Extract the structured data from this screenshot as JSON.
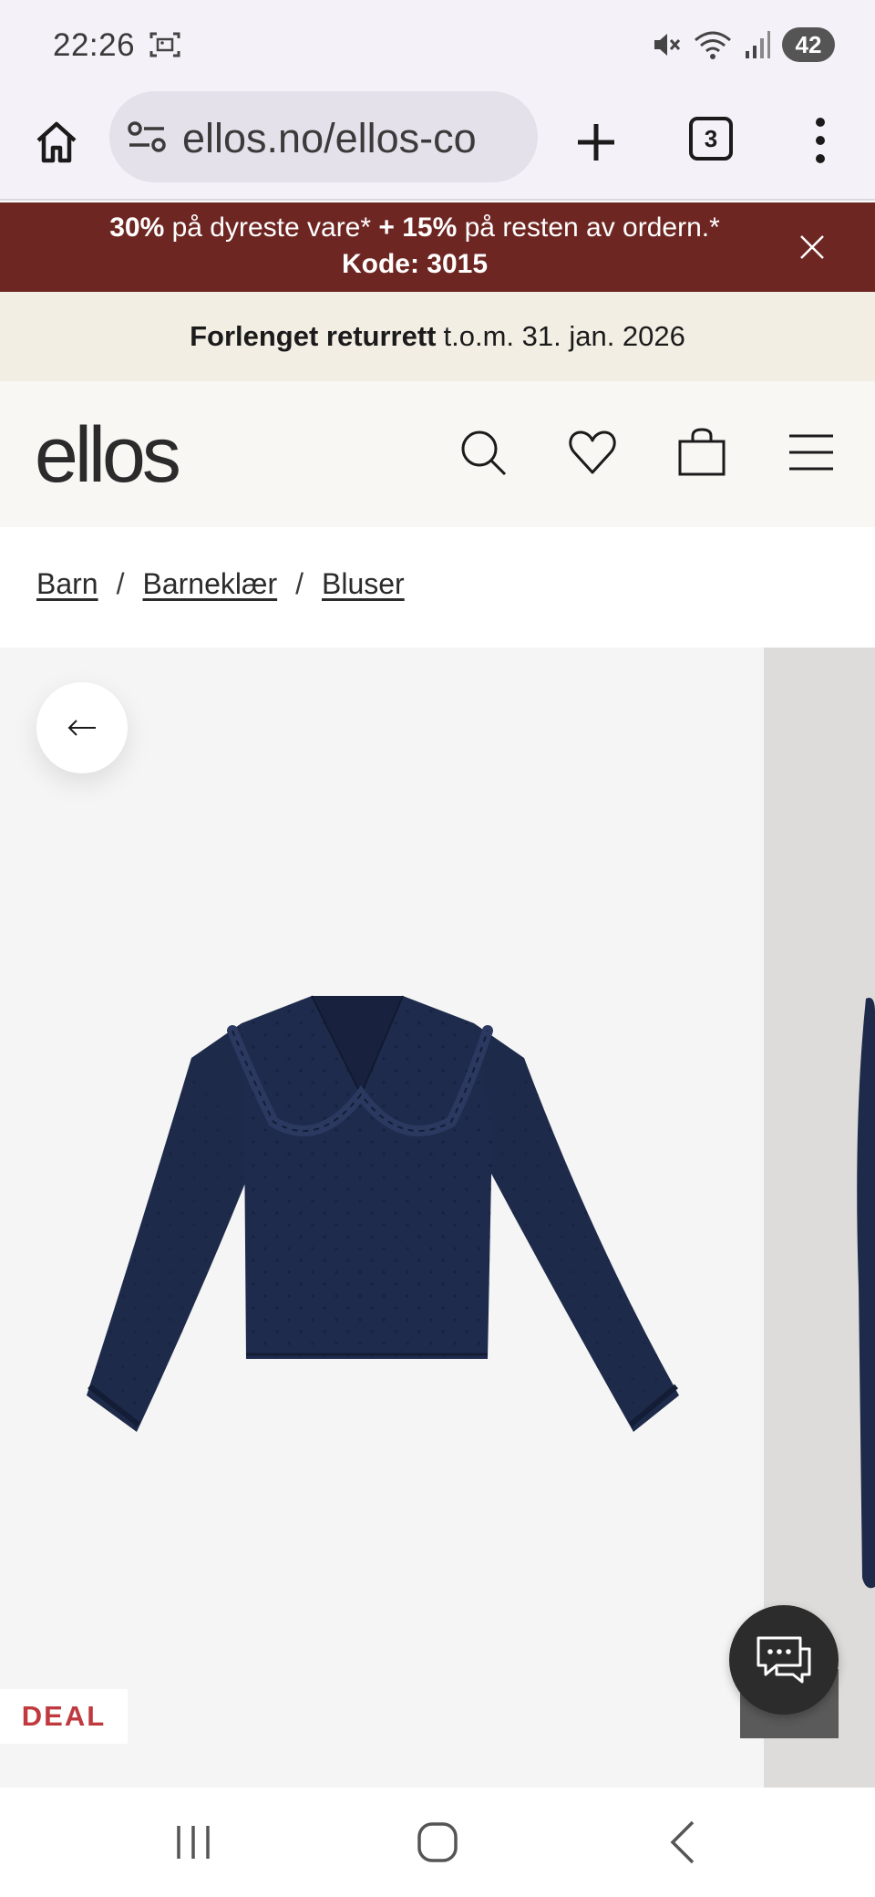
{
  "status_bar": {
    "time": "22:26",
    "battery": "42",
    "icons": [
      "screenshot-icon",
      "mute-icon",
      "wifi-icon",
      "signal-icon",
      "battery-icon"
    ]
  },
  "browser": {
    "url": "ellos.no/ellos-co",
    "tab_count": "3",
    "icons": [
      "home-icon",
      "site-settings-icon",
      "plus-icon",
      "tabs-icon",
      "more-vertical-icon"
    ]
  },
  "promo": {
    "pct1": "30%",
    "text1": " på dyreste vare* ",
    "pct2": "+ 15%",
    "text2": " på resten av ordern.* ",
    "code": "Kode: 3015",
    "background": "#6e2622"
  },
  "returns_banner": {
    "bold": "Forlenget returrett",
    "text": "t.o.m. 31. jan. 2026"
  },
  "site_header": {
    "logo": "ellos",
    "icons": [
      "search-icon",
      "heart-icon",
      "bag-icon",
      "hamburger-menu-icon"
    ]
  },
  "breadcrumb": {
    "items": [
      "Barn",
      "Barneklær",
      "Bluser"
    ],
    "separator": "/"
  },
  "product": {
    "badge": "DEAL",
    "badge_color": "#c0393f",
    "image": "navy-blouse-image"
  },
  "nav_bar": {
    "icons": [
      "recent-apps-icon",
      "home-nav-icon",
      "back-nav-icon"
    ]
  }
}
